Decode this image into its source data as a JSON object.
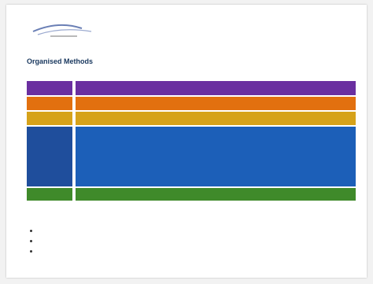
{
  "header": {
    "logo_name": "company-logo",
    "right_text": ""
  },
  "slide": {
    "title": "Organised Methods",
    "page_number": ""
  },
  "diagram": {
    "rows": [
      {
        "label": "",
        "text": "",
        "color": "#6a2fa0"
      },
      {
        "label": "",
        "text": "",
        "color": "#e2700f"
      },
      {
        "label": "",
        "text": "",
        "color": "#d6a21a"
      },
      {
        "label": "",
        "color": "#1c5fb8",
        "items": [
          "",
          "",
          "",
          "",
          "",
          ""
        ],
        "subitems": [
          "",
          ""
        ]
      },
      {
        "label": "",
        "text": "",
        "color": "#3f8a2a"
      }
    ]
  },
  "bullets": {
    "heading": "",
    "items": [
      "",
      "",
      ""
    ]
  }
}
